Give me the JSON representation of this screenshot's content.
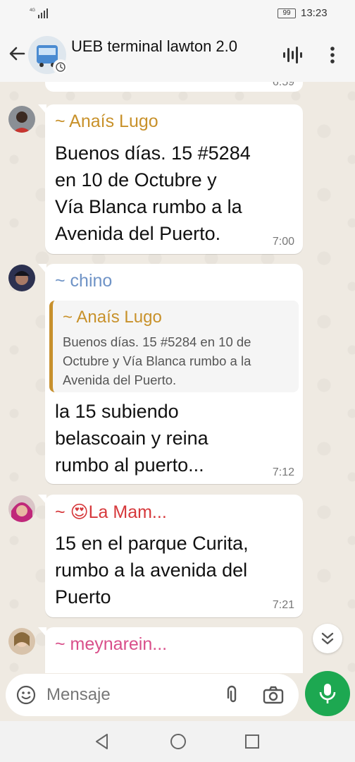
{
  "status_bar": {
    "time": "13:23",
    "battery": "99",
    "network": "4G"
  },
  "header": {
    "title": "UEB terminal lawton 2.0"
  },
  "messages": [
    {
      "time": "6:59"
    },
    {
      "sender": "~ Anaís Lugo",
      "sender_color": "#c8912a",
      "text_lines": [
        "Buenos días. 15 #5284",
        "en 10 de Octubre y",
        "Vía Blanca rumbo a la",
        "Avenida del Puerto."
      ],
      "time": "7:00"
    },
    {
      "sender": "~ chino",
      "sender_color": "#6f93c6",
      "quote": {
        "sender": "~ Anaís Lugo",
        "text": "Buenos días. 15 #5284 en 10 de Octubre y Vía Blanca rumbo a la Avenida del Puerto."
      },
      "text_lines": [
        "la 15 subiendo",
        "belascoain y reina",
        "rumbo al puerto..."
      ],
      "time": "7:12"
    },
    {
      "sender_prefix": "~",
      "sender_emoji": "😍",
      "sender": "La Mam...",
      "sender_color": "#d6383b",
      "text_lines": [
        "15 en el parque Curita,",
        "rumbo a la avenida del",
        "Puerto"
      ],
      "time": "7:21"
    },
    {
      "sender": "~ meynarein...",
      "sender_color": "#d94f8a"
    }
  ],
  "input": {
    "placeholder": "Mensaje"
  },
  "colors": {
    "accent": "#1da851",
    "chat_bg": "#efeae2"
  }
}
